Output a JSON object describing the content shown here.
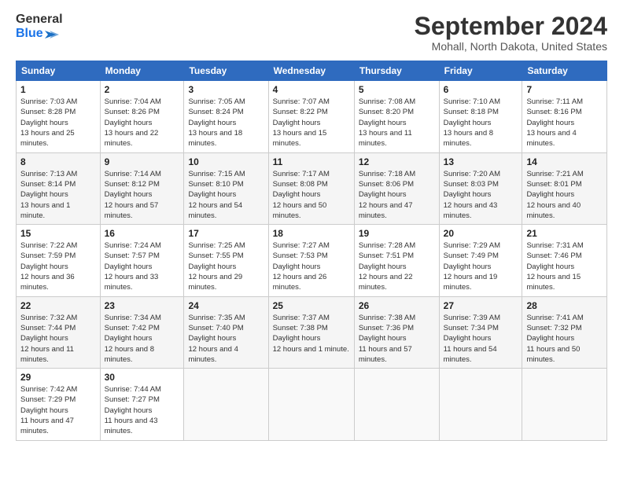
{
  "header": {
    "logo_line1": "General",
    "logo_line2": "Blue",
    "month": "September 2024",
    "location": "Mohall, North Dakota, United States"
  },
  "weekdays": [
    "Sunday",
    "Monday",
    "Tuesday",
    "Wednesday",
    "Thursday",
    "Friday",
    "Saturday"
  ],
  "weeks": [
    [
      {
        "day": "1",
        "sunrise": "7:03 AM",
        "sunset": "8:28 PM",
        "daylight": "13 hours and 25 minutes."
      },
      {
        "day": "2",
        "sunrise": "7:04 AM",
        "sunset": "8:26 PM",
        "daylight": "13 hours and 22 minutes."
      },
      {
        "day": "3",
        "sunrise": "7:05 AM",
        "sunset": "8:24 PM",
        "daylight": "13 hours and 18 minutes."
      },
      {
        "day": "4",
        "sunrise": "7:07 AM",
        "sunset": "8:22 PM",
        "daylight": "13 hours and 15 minutes."
      },
      {
        "day": "5",
        "sunrise": "7:08 AM",
        "sunset": "8:20 PM",
        "daylight": "13 hours and 11 minutes."
      },
      {
        "day": "6",
        "sunrise": "7:10 AM",
        "sunset": "8:18 PM",
        "daylight": "13 hours and 8 minutes."
      },
      {
        "day": "7",
        "sunrise": "7:11 AM",
        "sunset": "8:16 PM",
        "daylight": "13 hours and 4 minutes."
      }
    ],
    [
      {
        "day": "8",
        "sunrise": "7:13 AM",
        "sunset": "8:14 PM",
        "daylight": "13 hours and 1 minute."
      },
      {
        "day": "9",
        "sunrise": "7:14 AM",
        "sunset": "8:12 PM",
        "daylight": "12 hours and 57 minutes."
      },
      {
        "day": "10",
        "sunrise": "7:15 AM",
        "sunset": "8:10 PM",
        "daylight": "12 hours and 54 minutes."
      },
      {
        "day": "11",
        "sunrise": "7:17 AM",
        "sunset": "8:08 PM",
        "daylight": "12 hours and 50 minutes."
      },
      {
        "day": "12",
        "sunrise": "7:18 AM",
        "sunset": "8:06 PM",
        "daylight": "12 hours and 47 minutes."
      },
      {
        "day": "13",
        "sunrise": "7:20 AM",
        "sunset": "8:03 PM",
        "daylight": "12 hours and 43 minutes."
      },
      {
        "day": "14",
        "sunrise": "7:21 AM",
        "sunset": "8:01 PM",
        "daylight": "12 hours and 40 minutes."
      }
    ],
    [
      {
        "day": "15",
        "sunrise": "7:22 AM",
        "sunset": "7:59 PM",
        "daylight": "12 hours and 36 minutes."
      },
      {
        "day": "16",
        "sunrise": "7:24 AM",
        "sunset": "7:57 PM",
        "daylight": "12 hours and 33 minutes."
      },
      {
        "day": "17",
        "sunrise": "7:25 AM",
        "sunset": "7:55 PM",
        "daylight": "12 hours and 29 minutes."
      },
      {
        "day": "18",
        "sunrise": "7:27 AM",
        "sunset": "7:53 PM",
        "daylight": "12 hours and 26 minutes."
      },
      {
        "day": "19",
        "sunrise": "7:28 AM",
        "sunset": "7:51 PM",
        "daylight": "12 hours and 22 minutes."
      },
      {
        "day": "20",
        "sunrise": "7:29 AM",
        "sunset": "7:49 PM",
        "daylight": "12 hours and 19 minutes."
      },
      {
        "day": "21",
        "sunrise": "7:31 AM",
        "sunset": "7:46 PM",
        "daylight": "12 hours and 15 minutes."
      }
    ],
    [
      {
        "day": "22",
        "sunrise": "7:32 AM",
        "sunset": "7:44 PM",
        "daylight": "12 hours and 11 minutes."
      },
      {
        "day": "23",
        "sunrise": "7:34 AM",
        "sunset": "7:42 PM",
        "daylight": "12 hours and 8 minutes."
      },
      {
        "day": "24",
        "sunrise": "7:35 AM",
        "sunset": "7:40 PM",
        "daylight": "12 hours and 4 minutes."
      },
      {
        "day": "25",
        "sunrise": "7:37 AM",
        "sunset": "7:38 PM",
        "daylight": "12 hours and 1 minute."
      },
      {
        "day": "26",
        "sunrise": "7:38 AM",
        "sunset": "7:36 PM",
        "daylight": "11 hours and 57 minutes."
      },
      {
        "day": "27",
        "sunrise": "7:39 AM",
        "sunset": "7:34 PM",
        "daylight": "11 hours and 54 minutes."
      },
      {
        "day": "28",
        "sunrise": "7:41 AM",
        "sunset": "7:32 PM",
        "daylight": "11 hours and 50 minutes."
      }
    ],
    [
      {
        "day": "29",
        "sunrise": "7:42 AM",
        "sunset": "7:29 PM",
        "daylight": "11 hours and 47 minutes."
      },
      {
        "day": "30",
        "sunrise": "7:44 AM",
        "sunset": "7:27 PM",
        "daylight": "11 hours and 43 minutes."
      },
      null,
      null,
      null,
      null,
      null
    ]
  ]
}
